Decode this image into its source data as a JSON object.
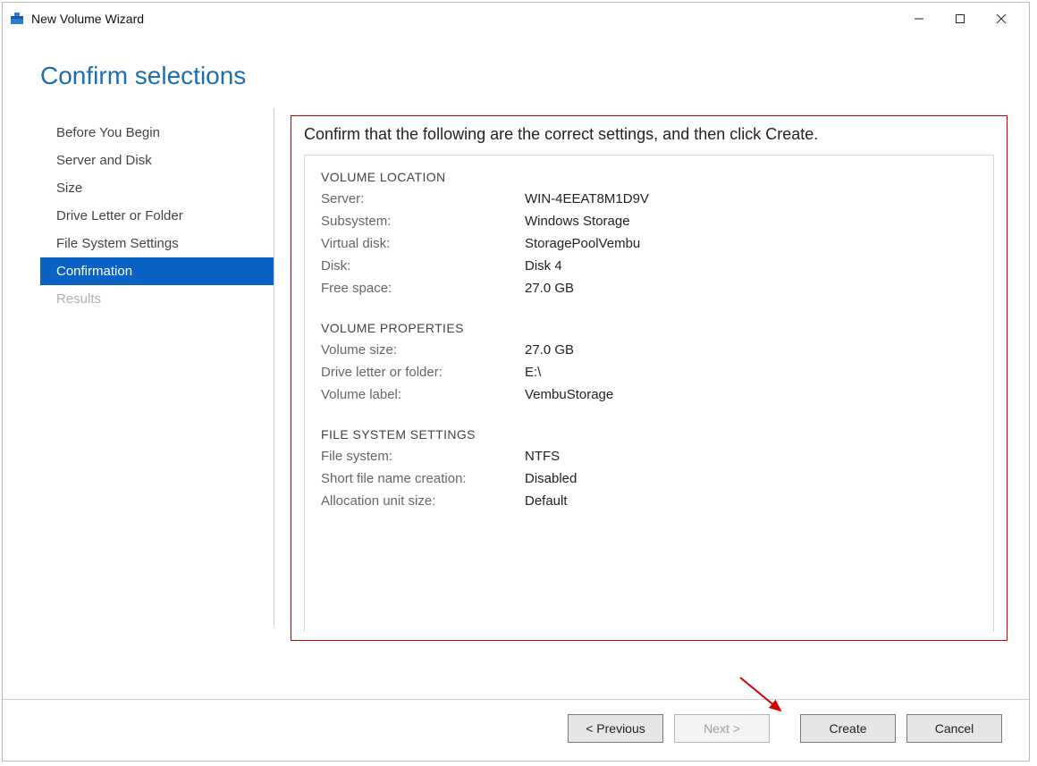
{
  "window": {
    "title": "New Volume Wizard"
  },
  "heading": "Confirm selections",
  "sidebar": {
    "items": [
      {
        "label": "Before You Begin",
        "state": "normal"
      },
      {
        "label": "Server and Disk",
        "state": "normal"
      },
      {
        "label": "Size",
        "state": "normal"
      },
      {
        "label": "Drive Letter or Folder",
        "state": "normal"
      },
      {
        "label": "File System Settings",
        "state": "normal"
      },
      {
        "label": "Confirmation",
        "state": "selected"
      },
      {
        "label": "Results",
        "state": "disabled"
      }
    ]
  },
  "main": {
    "instruction": "Confirm that the following are the correct settings, and then click Create.",
    "sections": [
      {
        "heading": "VOLUME LOCATION",
        "rows": [
          {
            "label": "Server:",
            "value": "WIN-4EEAT8M1D9V"
          },
          {
            "label": "Subsystem:",
            "value": "Windows Storage"
          },
          {
            "label": "Virtual disk:",
            "value": "StoragePoolVembu"
          },
          {
            "label": "Disk:",
            "value": "Disk 4"
          },
          {
            "label": "Free space:",
            "value": "27.0 GB"
          }
        ]
      },
      {
        "heading": "VOLUME PROPERTIES",
        "rows": [
          {
            "label": "Volume size:",
            "value": "27.0 GB"
          },
          {
            "label": "Drive letter or folder:",
            "value": "E:\\"
          },
          {
            "label": "Volume label:",
            "value": "VembuStorage"
          }
        ]
      },
      {
        "heading": "FILE SYSTEM SETTINGS",
        "rows": [
          {
            "label": "File system:",
            "value": "NTFS"
          },
          {
            "label": "Short file name creation:",
            "value": "Disabled"
          },
          {
            "label": "Allocation unit size:",
            "value": "Default"
          }
        ]
      }
    ]
  },
  "buttons": {
    "previous": "< Previous",
    "next": "Next >",
    "create": "Create",
    "cancel": "Cancel"
  }
}
